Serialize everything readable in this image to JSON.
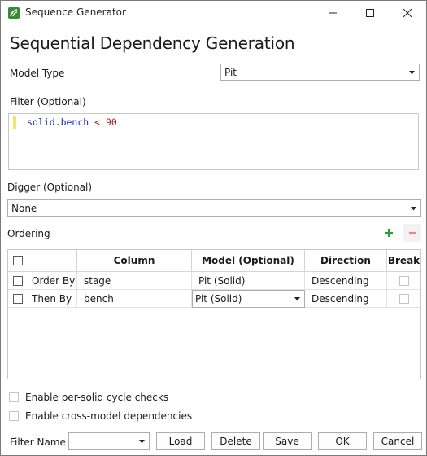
{
  "window": {
    "title": "Sequence Generator"
  },
  "heading": "Sequential Dependency Generation",
  "model_type": {
    "label": "Model Type",
    "value": "Pit"
  },
  "filter": {
    "label": "Filter (Optional)",
    "code": {
      "ident": "solid",
      "dot": ".",
      "field": "bench",
      "op": "<",
      "num": "90"
    }
  },
  "digger": {
    "label": "Digger (Optional)",
    "value": "None"
  },
  "ordering": {
    "label": "Ordering",
    "columns": [
      "",
      "",
      "Column",
      "Model (Optional)",
      "Direction",
      "Break"
    ],
    "rows": [
      {
        "type": "Order By",
        "column": "stage",
        "model": "Pit (Solid)",
        "direction": "Descending"
      },
      {
        "type": "Then By",
        "column": "bench",
        "model": "Pit (Solid)",
        "direction": "Descending"
      }
    ]
  },
  "options": {
    "per_solid": "Enable per-solid cycle checks",
    "cross_model": "Enable cross-model dependencies"
  },
  "footer": {
    "filter_name_label": "Filter Name",
    "filter_name_value": "",
    "load": "Load",
    "delete": "Delete",
    "save": "Save",
    "ok": "OK",
    "cancel": "Cancel"
  },
  "colors": {
    "accent_green": "#2e9a3a",
    "minus_red": "#e08a8a",
    "app_icon": "#3a8a3a"
  }
}
